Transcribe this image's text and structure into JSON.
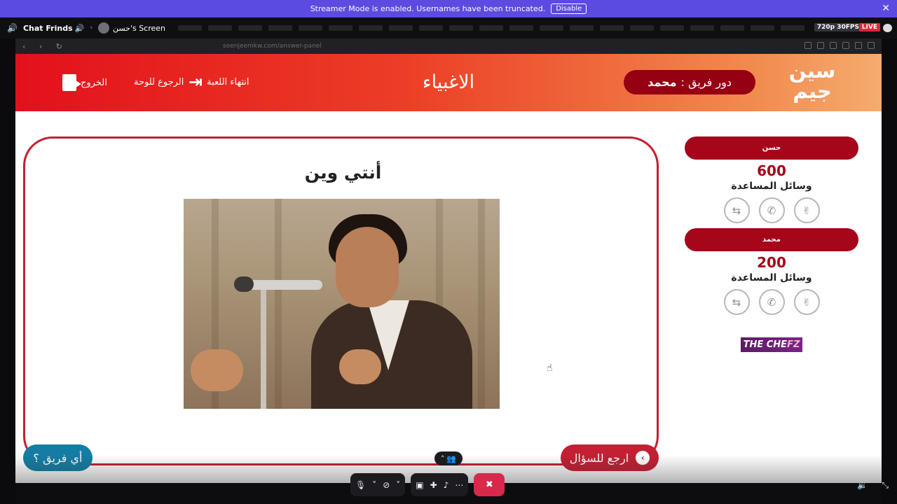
{
  "banner": {
    "message": "Streamer Mode is enabled. Usernames have been truncated.",
    "disable_label": "Disable"
  },
  "stream": {
    "channel_name": "Chat Frinds",
    "screen_title": "حسن's Screen",
    "quality": "720p 30FPS",
    "live_label": "LIVE"
  },
  "browser": {
    "url": "seenjeemkw.com/answer-panel"
  },
  "app": {
    "logo_line1": "سين",
    "logo_line2": "جيم",
    "turn_label": "دور فريق :",
    "turn_team": "محمد",
    "category": "الاغبياء",
    "actions": {
      "end_game": "انتهاء اللعبة",
      "back_to_board": "الرجوع للوحة",
      "exit": "الخروج"
    }
  },
  "question": {
    "text": "أنتي وين",
    "back_to_question": "ارجع للسؤال",
    "which_team": "أي فريق ؟"
  },
  "teams": [
    {
      "name": "حسن",
      "score": "600",
      "helpers_label": "وسائل المساعدة",
      "helpers": [
        "hand-peace-icon",
        "phone-icon",
        "swap-icon"
      ]
    },
    {
      "name": "محمد",
      "score": "200",
      "helpers_label": "وسائل المساعدة",
      "helpers": [
        "hand-peace-icon",
        "phone-icon",
        "swap-icon"
      ]
    }
  ],
  "sponsor": {
    "part1": "THE CHE",
    "part2": "FZ"
  },
  "colors": {
    "primary_red": "#c41f33",
    "dark_red": "#a6061a",
    "teal": "#157da3",
    "banner_purple": "#5b4be0",
    "end_call": "#d8294a"
  }
}
